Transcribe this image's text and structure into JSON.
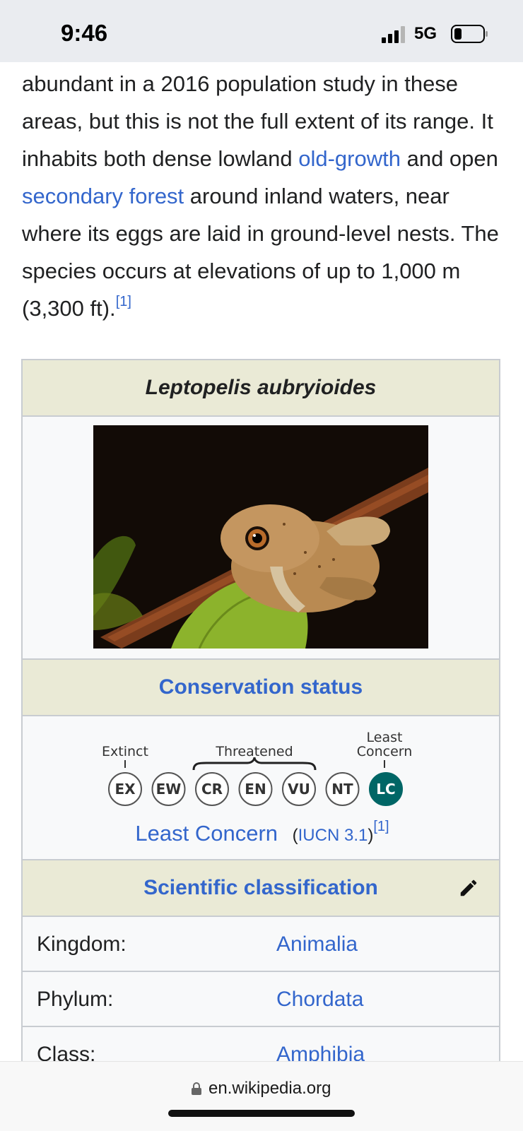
{
  "status_bar": {
    "time": "9:46",
    "network": "5Gᵂ",
    "network_display": "5G"
  },
  "article": {
    "p1": "abundant in a 2016 population study in these areas, but this is not the full extent of its range. It inhabits both dense lowland ",
    "link_old_growth": "old-growth",
    "p2": " and open ",
    "link_secondary_forest": "secondary forest",
    "p3": " around inland waters, near where its eggs are laid in ground-level nests. The species occurs at elevations of up to 1,000 m (3,300 ft).",
    "ref": "[1]"
  },
  "infobox": {
    "title": "Leptopelis aubryioides",
    "conservation_heading": "Conservation status",
    "scale": {
      "extinct_label": "Extinct",
      "threatened_label": "Threatened",
      "least_concern_label_1": "Least",
      "least_concern_label_2": "Concern",
      "categories": [
        "EX",
        "EW",
        "CR",
        "EN",
        "VU",
        "NT",
        "LC"
      ],
      "selected": "LC",
      "selected_color": "#006666"
    },
    "status_text": "Least Concern",
    "iucn_open": "(",
    "iucn_link": "IUCN 3.1",
    "iucn_close": ")",
    "status_ref": "[1]",
    "classification_heading": "Scientific classification",
    "taxonomy": [
      {
        "label": "Kingdom:",
        "value": "Animalia"
      },
      {
        "label": "Phylum:",
        "value": "Chordata"
      },
      {
        "label": "Class:",
        "value": "Amphibia"
      }
    ]
  },
  "browser": {
    "url": "en.wikipedia.org"
  },
  "colors": {
    "link": "#3366cc",
    "infobox_header": "#eaead6",
    "border": "#c8ccd1"
  }
}
